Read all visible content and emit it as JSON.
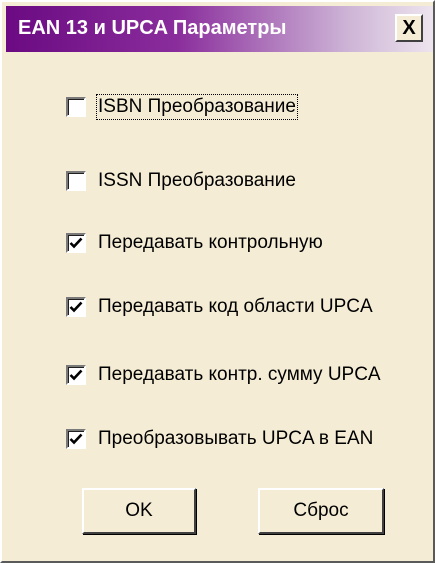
{
  "window": {
    "title": "EAN 13 и UPCA Параметры",
    "close_label": "X"
  },
  "options": [
    {
      "label": "ISBN Преобразование",
      "checked": false
    },
    {
      "label": "ISSN Преобразование",
      "checked": false
    },
    {
      "label": "Передавать контрольную",
      "checked": true
    },
    {
      "label": "Передавать код области UPCA",
      "checked": true
    },
    {
      "label": "Передавать контр. сумму UPCA",
      "checked": true
    },
    {
      "label": "Преобразовывать UPCA в EAN",
      "checked": true
    }
  ],
  "buttons": {
    "ok_label": "OK",
    "reset_label": "Сброс"
  },
  "colors": {
    "title_gradient_start": "#6b0a82",
    "dialog_background": "#f4ecd4"
  }
}
